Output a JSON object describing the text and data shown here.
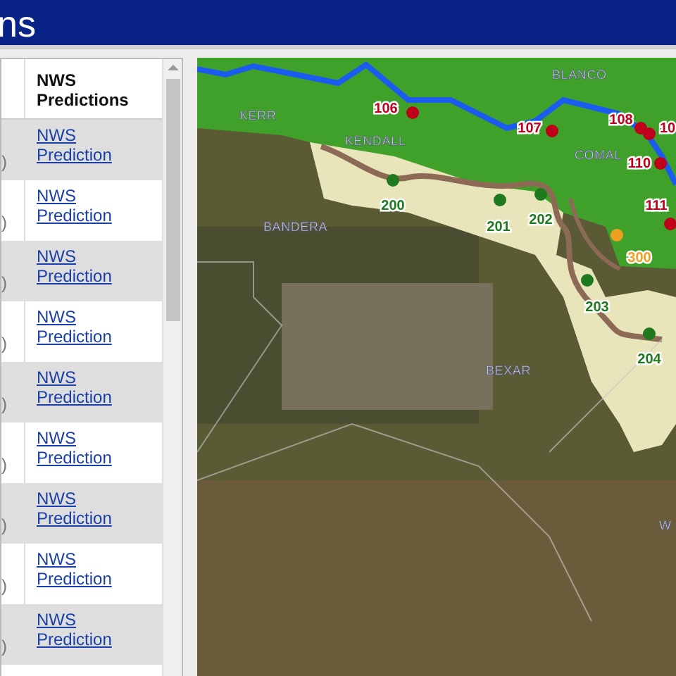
{
  "header": {
    "title": "ns"
  },
  "table": {
    "columns": [
      "",
      "NWS Predictions"
    ],
    "rows": [
      {
        "column_1": ")",
        "link": "NWS Prediction",
        "shaded": true
      },
      {
        "column_1": ")",
        "link": "NWS Prediction",
        "shaded": false
      },
      {
        "column_1": ")",
        "link": "NWS Prediction",
        "shaded": true
      },
      {
        "column_1": ")",
        "link": "NWS Prediction",
        "shaded": false
      },
      {
        "column_1": ")",
        "link": "NWS Prediction",
        "shaded": true
      },
      {
        "column_1": ")",
        "link": "NWS Prediction",
        "shaded": false
      },
      {
        "column_1": ")",
        "link": "NWS Prediction",
        "shaded": true
      },
      {
        "column_1": ")",
        "link": "NWS Prediction",
        "shaded": false
      },
      {
        "column_1": ")",
        "link": "NWS Prediction",
        "shaded": true
      }
    ]
  },
  "map": {
    "labels": [
      {
        "kind": "county",
        "text": "BLANCO"
      },
      {
        "kind": "county",
        "text": "KERR"
      },
      {
        "kind": "county",
        "text": "KENDALL"
      },
      {
        "kind": "county",
        "text": "COMAL"
      },
      {
        "kind": "county",
        "text": "BANDERA"
      },
      {
        "kind": "county",
        "text": "BEXAR"
      },
      {
        "kind": "county",
        "text": "W"
      },
      {
        "kind": "gauge",
        "text": "106",
        "color": "#c0001a"
      },
      {
        "kind": "gauge",
        "text": "107",
        "color": "#c0001a"
      },
      {
        "kind": "gauge",
        "text": "108",
        "color": "#c0001a"
      },
      {
        "kind": "gauge",
        "text": "10",
        "color": "#c0001a"
      },
      {
        "kind": "gauge",
        "text": "110",
        "color": "#c0001a"
      },
      {
        "kind": "gauge",
        "text": "111",
        "color": "#c0001a"
      },
      {
        "kind": "gauge",
        "text": "200",
        "color": "#1f7a1f"
      },
      {
        "kind": "gauge",
        "text": "201",
        "color": "#1f7a1f"
      },
      {
        "kind": "gauge",
        "text": "202",
        "color": "#1f7a1f"
      },
      {
        "kind": "gauge",
        "text": "203",
        "color": "#1f7a1f"
      },
      {
        "kind": "gauge",
        "text": "204",
        "color": "#1f7a1f"
      },
      {
        "kind": "gauge",
        "text": "300",
        "color": "#f0a020"
      }
    ]
  }
}
